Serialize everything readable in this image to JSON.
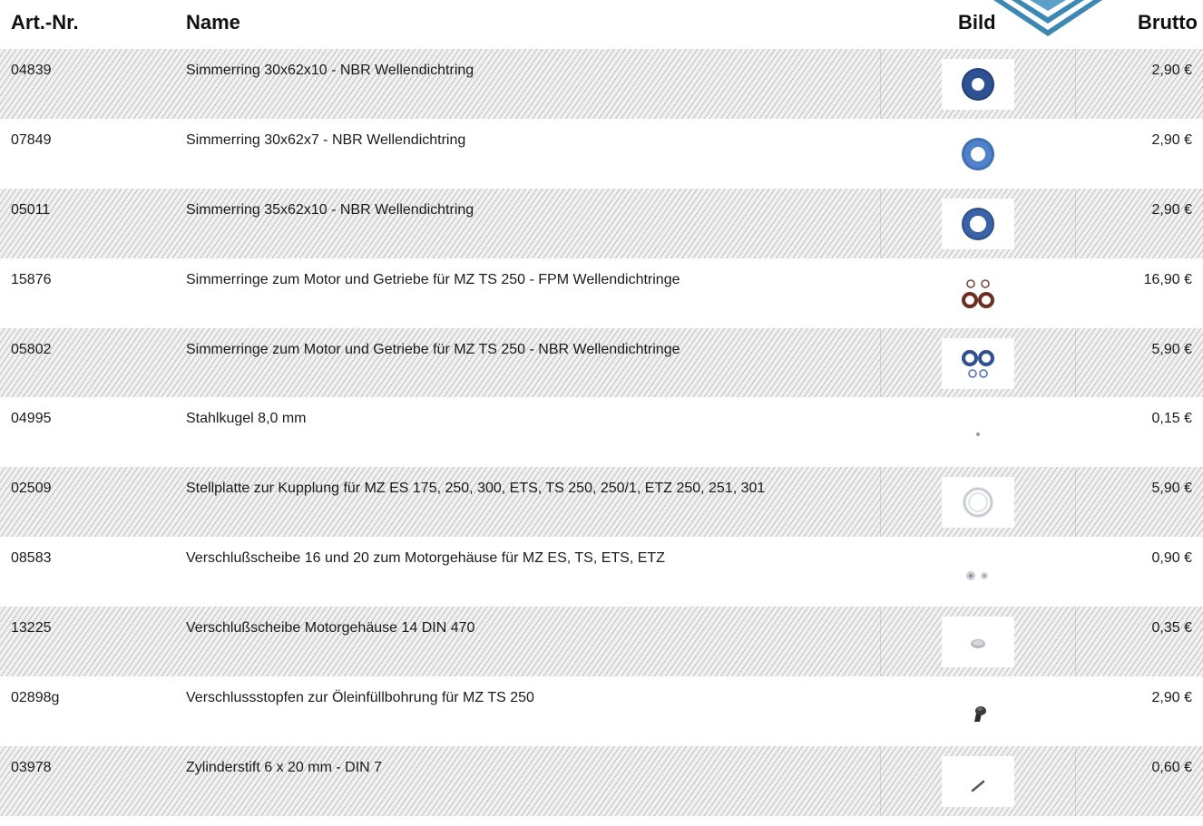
{
  "header": {
    "art_nr": "Art.-Nr.",
    "name": "Name",
    "bild": "Bild",
    "brutto": "Brutto"
  },
  "logo": {
    "icon": "diamond-logo",
    "color": "#4a90b8"
  },
  "colors": {
    "hatch": "#969696",
    "ring_blue": "#3f69a3",
    "ring_brown": "#8b3a2a"
  },
  "rows": [
    {
      "art": "04839",
      "name": "Simmerring 30x62x10 - NBR Wellendichtring",
      "price": "2,90 €",
      "image": "blue-seal-ring-thick"
    },
    {
      "art": "07849",
      "name": "Simmerring 30x62x7 - NBR Wellendichtring",
      "price": "2,90 €",
      "image": "blue-seal-ring-thin"
    },
    {
      "art": "05011",
      "name": "Simmerring 35x62x10 - NBR Wellendichtring",
      "price": "2,90 €",
      "image": "blue-seal-ring"
    },
    {
      "art": "15876",
      "name": "Simmerringe zum Motor und Getriebe für MZ TS 250 - FPM Wellendichtringe",
      "price": "16,90 €",
      "image": "brown-seal-ring-set"
    },
    {
      "art": "05802",
      "name": "Simmerringe zum Motor und Getriebe für MZ TS 250 - NBR Wellendichtringe",
      "price": "5,90 €",
      "image": "blue-seal-ring-set"
    },
    {
      "art": "04995",
      "name": "Stahlkugel 8,0 mm",
      "price": "0,15 €",
      "image": "steel-ball"
    },
    {
      "art": "02509",
      "name": "Stellplatte zur Kupplung für MZ ES 175, 250, 300, ETS, TS 250, 250/1, ETZ 250, 251, 301",
      "price": "5,90 €",
      "image": "clutch-plate"
    },
    {
      "art": "08583",
      "name": "Verschlußscheibe 16 und 20 zum Motorgehäuse für MZ ES, TS, ETS, ETZ",
      "price": "0,90 €",
      "image": "sealing-discs"
    },
    {
      "art": "13225",
      "name": "Verschlußscheibe Motorgehäuse 14 DIN 470",
      "price": "0,35 €",
      "image": "sealing-disc"
    },
    {
      "art": "02898g",
      "name": "Verschlussstopfen zur Öleinfüllbohrung für MZ TS 250",
      "price": "2,90 €",
      "image": "oil-plug"
    },
    {
      "art": "03978",
      "name": "Zylinderstift 6 x 20 mm - DIN 7",
      "price": "0,60 €",
      "image": "cylinder-pin"
    }
  ]
}
